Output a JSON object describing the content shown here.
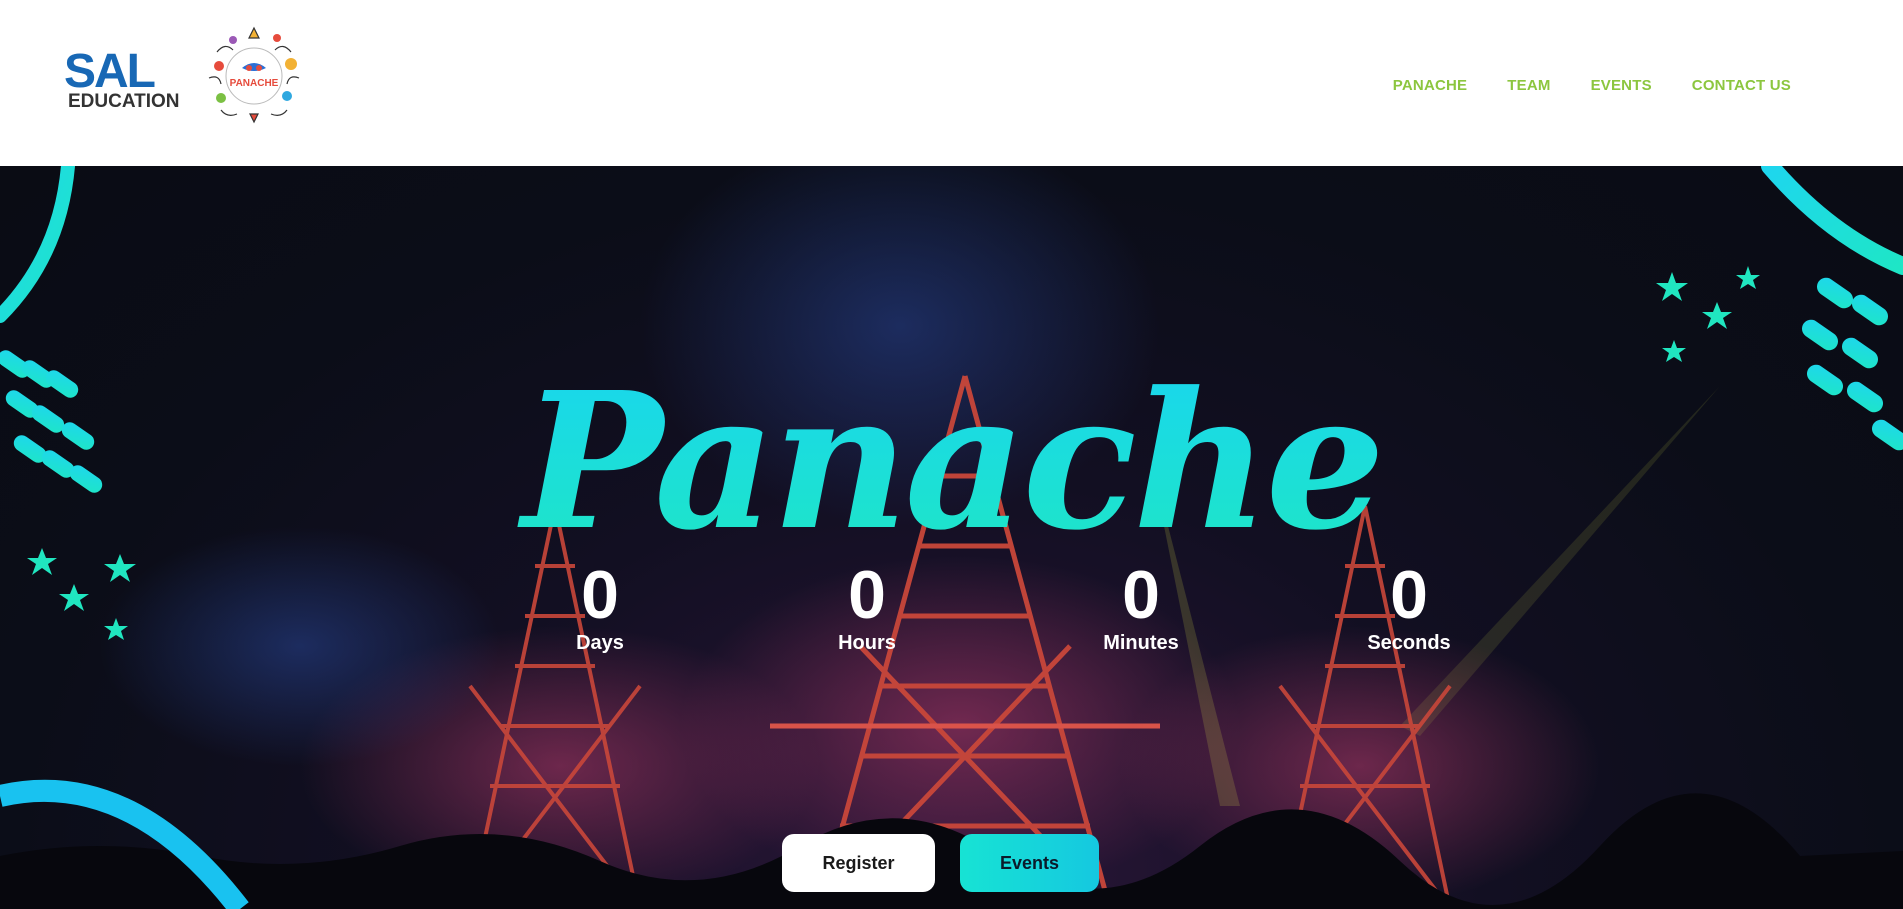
{
  "brand": {
    "sal_word": "SAL",
    "sal_sub": "EDUCATION",
    "badge_text": "PANACHE",
    "colors": {
      "sal_blue": "#1868b5",
      "sal_green": "#46b33c",
      "nav_green": "#8cc63f",
      "accent_teal": "#1ee6c6",
      "accent_cyan": "#19d6ee"
    }
  },
  "nav": {
    "items": [
      {
        "label": "PANACHE"
      },
      {
        "label": "TEAM"
      },
      {
        "label": "EVENTS"
      },
      {
        "label": "CONTACT US"
      }
    ]
  },
  "hero": {
    "title": "Panache",
    "countdown": [
      {
        "value": "0",
        "label": "Days"
      },
      {
        "value": "0",
        "label": "Hours"
      },
      {
        "value": "0",
        "label": "Minutes"
      },
      {
        "value": "0",
        "label": "Seconds"
      }
    ],
    "buttons": {
      "register": "Register",
      "events": "Events"
    }
  }
}
